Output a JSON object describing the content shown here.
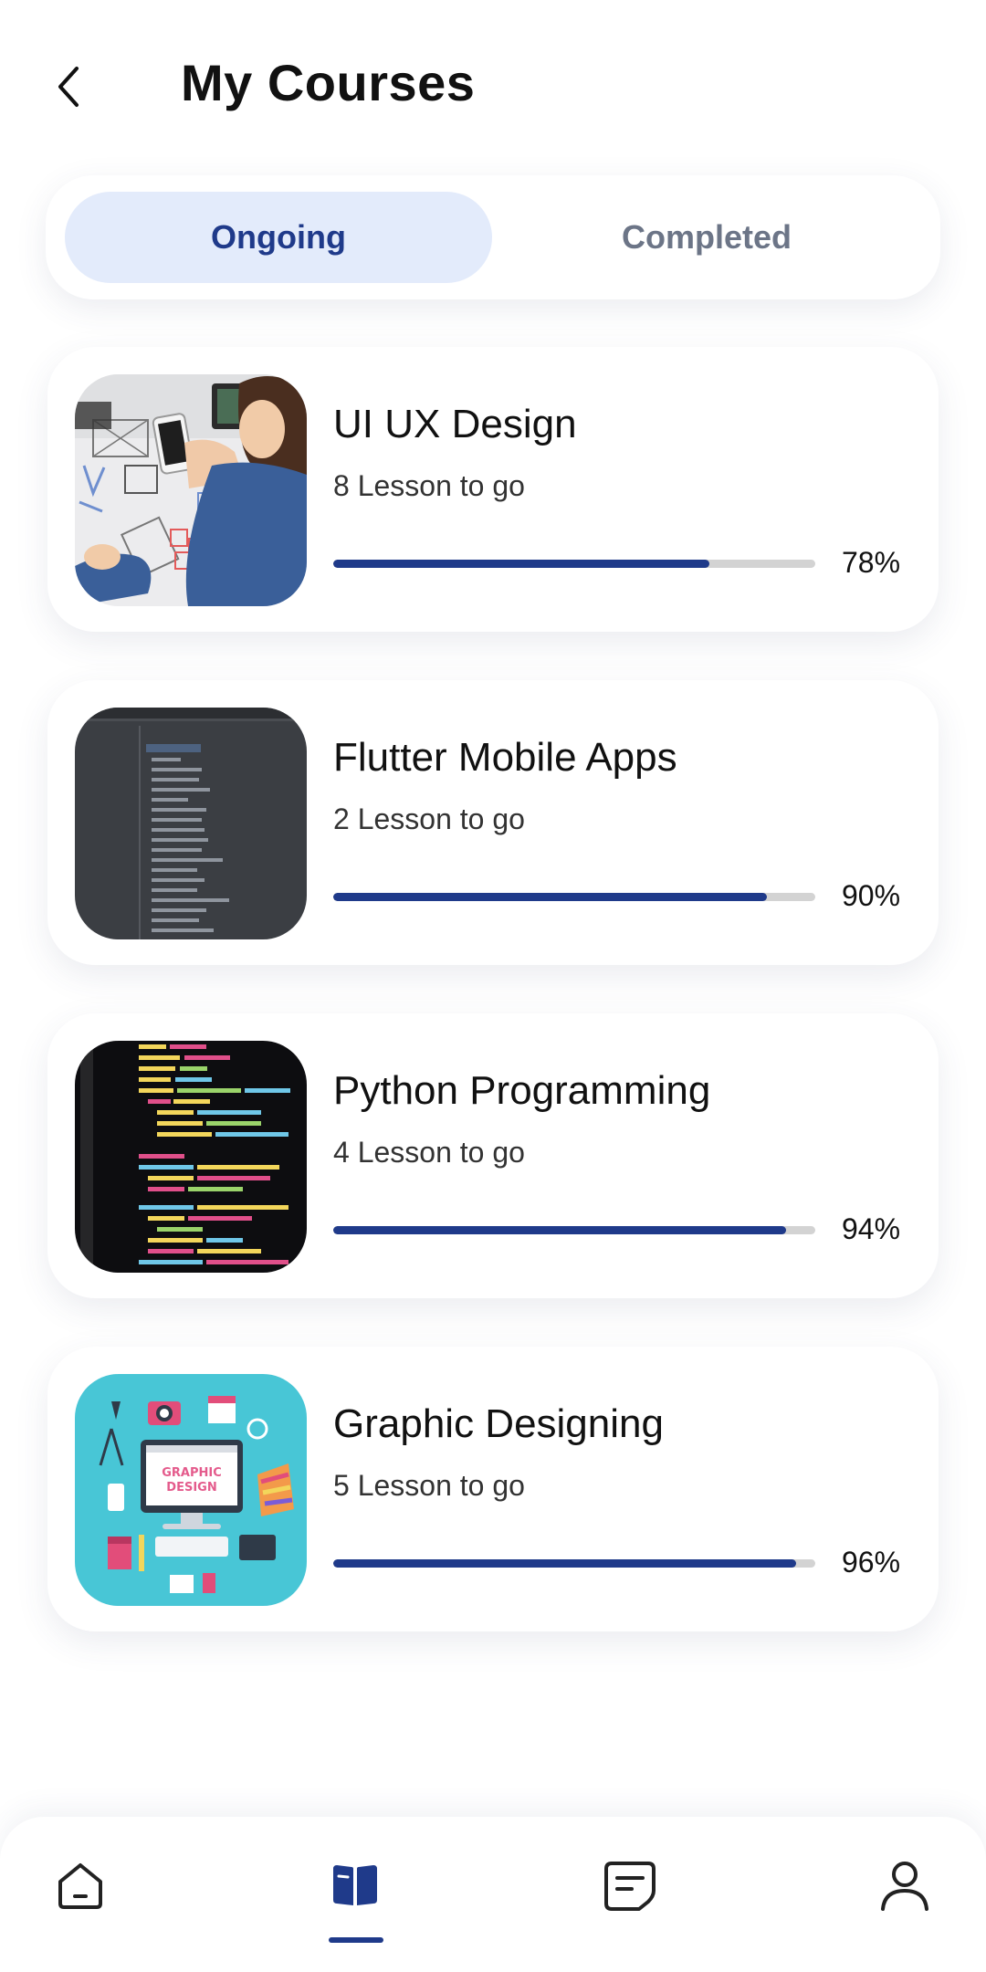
{
  "header": {
    "title": "My Courses",
    "back_icon": "chevron-left-icon"
  },
  "tabs": [
    {
      "label": "Ongoing",
      "active": true
    },
    {
      "label": "Completed",
      "active": false
    }
  ],
  "courses": [
    {
      "title": "UI UX Design",
      "subtitle": "8 Lesson to go",
      "progress": 78,
      "progress_label": "78%",
      "thumbnail": "ui-ux-design-photo"
    },
    {
      "title": "Flutter Mobile Apps",
      "subtitle": "2 Lesson to go",
      "progress": 90,
      "progress_label": "90%",
      "thumbnail": "flutter-code-screenshot"
    },
    {
      "title": "Python Programming",
      "subtitle": "4 Lesson to go",
      "progress": 94,
      "progress_label": "94%",
      "thumbnail": "python-code-screenshot"
    },
    {
      "title": "Graphic Designing",
      "subtitle": "5 Lesson to go",
      "progress": 96,
      "progress_label": "96%",
      "thumbnail": "graphic-design-illustration"
    }
  ],
  "thumbnail_text": {
    "graphic_design_line1": "GRAPHIC",
    "graphic_design_line2": "DESIGN"
  },
  "bottom_nav": [
    {
      "icon": "home-icon",
      "active": false
    },
    {
      "icon": "book-icon",
      "active": true
    },
    {
      "icon": "message-icon",
      "active": false
    },
    {
      "icon": "profile-icon",
      "active": false
    }
  ],
  "colors": {
    "accent": "#1f3a8a",
    "tab_active_bg": "#e3ebfb",
    "tab_inactive_text": "#6c7587",
    "progress_track": "#d3d3d3"
  }
}
